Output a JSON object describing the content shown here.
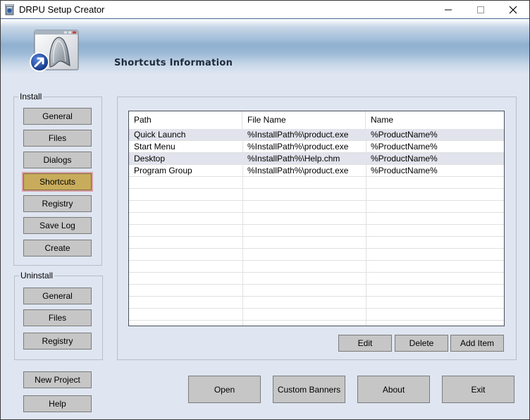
{
  "window": {
    "title": "DRPU Setup Creator",
    "controls": {
      "minimize": "minimize",
      "maximize": "maximize",
      "close": "close"
    }
  },
  "banner": {
    "title": "Shortcuts Information",
    "icon": "shortcut-window-icon"
  },
  "install_group": {
    "label": "Install",
    "buttons": [
      {
        "label": "General"
      },
      {
        "label": "Files"
      },
      {
        "label": "Dialogs"
      },
      {
        "label": "Shortcuts",
        "active": true
      },
      {
        "label": "Registry"
      },
      {
        "label": "Save Log"
      },
      {
        "label": "Create"
      }
    ]
  },
  "uninstall_group": {
    "label": "Uninstall",
    "buttons": [
      {
        "label": "General"
      },
      {
        "label": "Files"
      },
      {
        "label": "Registry"
      }
    ]
  },
  "side_buttons": {
    "new_project": "New Project",
    "help": "Help"
  },
  "shortcuts_table": {
    "columns": [
      "Path",
      "File Name",
      "Name"
    ],
    "rows": [
      [
        "Quick Launch",
        "%InstallPath%\\product.exe",
        "%ProductName%"
      ],
      [
        "Start Menu",
        "%InstallPath%\\product.exe",
        "%ProductName%"
      ],
      [
        "Desktop",
        "%InstallPath%\\Help.chm",
        "%ProductName%"
      ],
      [
        "Program Group",
        "%InstallPath%\\product.exe",
        "%ProductName%"
      ]
    ]
  },
  "table_actions": {
    "edit": "Edit",
    "delete": "Delete",
    "add_item": "Add Item"
  },
  "bottom_buttons": {
    "open": "Open",
    "custom_banners": "Custom Banners",
    "about": "About",
    "exit": "Exit"
  },
  "colors": {
    "window_bg": "#dfe6f1",
    "active_button": "#c8ac5c",
    "button_bg": "#c6c6c6",
    "row_shade": "#e1e4ec"
  }
}
